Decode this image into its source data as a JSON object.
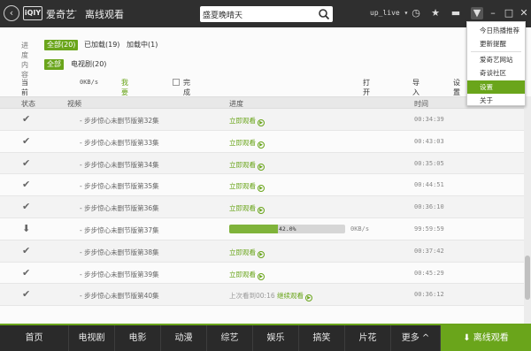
{
  "titlebar": {
    "brand": "爱奇艺",
    "section": "离线观看",
    "search_value": "盛夏晚晴天",
    "username": "up_live"
  },
  "filters": {
    "progress_label": "进度",
    "progress_options": [
      "全部(20)",
      "已加载(19)",
      "加载中(1)"
    ],
    "content_label": "内容",
    "content_options": [
      "全部",
      "电视剧(20)"
    ]
  },
  "toolbar": {
    "speed_label": "当前加载速度:",
    "speed_value": "0KB/s",
    "boost_link": "我要提速",
    "shutdown_label": "完成后自动关机",
    "open_folder": "打开文件夹",
    "import_file": "导入文件",
    "settings": "设置"
  },
  "columns": {
    "status": "状态",
    "video": "视频",
    "progress": "进度",
    "time": "时间"
  },
  "rows": [
    {
      "title": "- 步步惊心未删节版第32集",
      "watch": "立即观看",
      "time": "00:34:39"
    },
    {
      "title": "- 步步惊心未删节版第33集",
      "watch": "立即观看",
      "time": "00:43:03"
    },
    {
      "title": "- 步步惊心未删节版第34集",
      "watch": "立即观看",
      "time": "00:35:05"
    },
    {
      "title": "- 步步惊心未删节版第35集",
      "watch": "立即观看",
      "time": "00:44:51"
    },
    {
      "title": "- 步步惊心未删节版第36集",
      "watch": "立即观看",
      "time": "00:36:10"
    },
    {
      "title": "- 步步惊心未删节版第37集",
      "progress_text": "42.0%",
      "progress": 0.42,
      "rate": "0KB/s",
      "time": "99:59:59"
    },
    {
      "title": "- 步步惊心未删节版第38集",
      "watch": "立即观看",
      "time": "00:37:42"
    },
    {
      "title": "- 步步惊心未删节版第39集",
      "watch": "立即观看",
      "time": "00:45:29"
    },
    {
      "title": "- 步步惊心未删节版第40集",
      "last_watched": "上次看到00:16",
      "continue": "继续观看",
      "time": "00:36:12"
    }
  ],
  "bottom_nav": [
    "首页",
    "电视剧",
    "电影",
    "动漫",
    "综艺",
    "娱乐",
    "搞笑",
    "片花",
    "更多",
    "离线观看"
  ],
  "dropdown": [
    "今日热播推荐",
    "更新提醒",
    "爱奇艺网站",
    "奇谈社区",
    "设置",
    "关于"
  ],
  "colors": {
    "accent": "#6aa51b",
    "titlebar": "#2f2f2f"
  }
}
